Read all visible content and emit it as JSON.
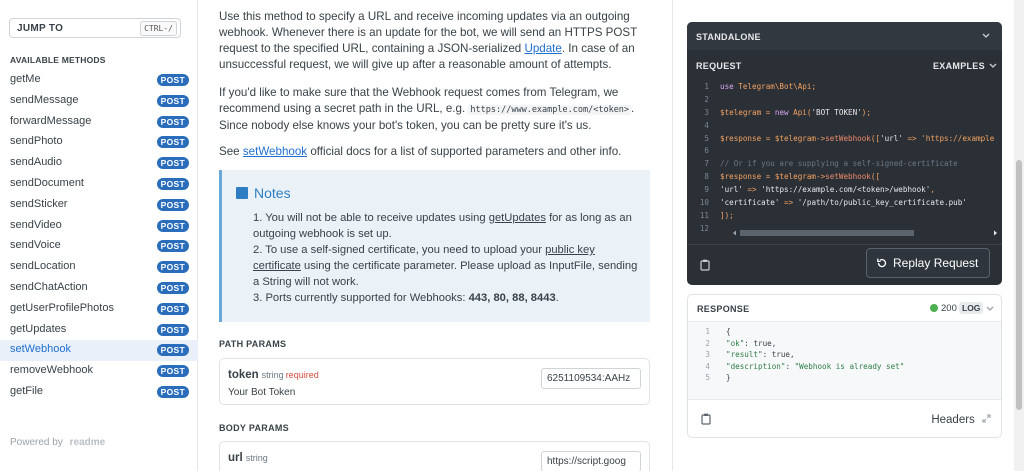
{
  "sidebar": {
    "jump_to": "JUMP TO",
    "jump_shortcut": "CTRL-/",
    "methods_title": "AVAILABLE METHODS",
    "badge": "POST",
    "items": [
      {
        "label": "getMe"
      },
      {
        "label": "sendMessage"
      },
      {
        "label": "forwardMessage"
      },
      {
        "label": "sendPhoto"
      },
      {
        "label": "sendAudio"
      },
      {
        "label": "sendDocument"
      },
      {
        "label": "sendSticker"
      },
      {
        "label": "sendVideo"
      },
      {
        "label": "sendVoice"
      },
      {
        "label": "sendLocation"
      },
      {
        "label": "sendChatAction"
      },
      {
        "label": "getUserProfilePhotos"
      },
      {
        "label": "getUpdates"
      },
      {
        "label": "setWebhook"
      },
      {
        "label": "removeWebhook"
      },
      {
        "label": "getFile"
      }
    ],
    "active_item": "setWebhook",
    "powered_by": "Powered by",
    "brand": "readme"
  },
  "main": {
    "intro_before_link": "Use this method to specify a URL and receive incoming updates via an outgoing webhook. Whenever there is an update for the bot, we will send an HTTPS POST request to the specified URL, containing a JSON-serialized ",
    "intro_link": "Update",
    "intro_after_link": ". In case of an unsuccessful request, we will give up after a reasonable amount of attempts.",
    "secret_before": "If you'd like to make sure that the Webhook request comes from Telegram, we recommend using a secret path in the URL, e.g. ",
    "secret_code": "https://www.example.com/<token>",
    "secret_after": ". Since nobody else knows your bot's token, you can be pretty sure it's us.",
    "see_prefix": "See ",
    "see_link": "setWebhook",
    "see_suffix": " official docs for a list of supported parameters and other info.",
    "notes": {
      "title": "Notes",
      "n1_pre": "1. You will not be able to receive updates using ",
      "n1_link": "getUpdates",
      "n1_post": " for as long as an outgoing webhook is set up.",
      "n2_pre": "2. To use a self-signed certificate, you need to upload your ",
      "n2_link": "public key certificate",
      "n2_post": " using the certificate parameter. Please upload as InputFile, sending a String will not work.",
      "n3_pre": "3. Ports currently supported for Webhooks: ",
      "n3_ports": "443, 80, 88, 8443",
      "n3_post": "."
    },
    "path_params_title": "PATH PARAMS",
    "token_param": {
      "name": "token",
      "type": "string",
      "required": "required",
      "description": "Your Bot Token",
      "value": "6251109534:AAHz"
    },
    "body_params_title": "BODY PARAMS",
    "url_param": {
      "name": "url",
      "type": "string",
      "value": "https://script.goog"
    }
  },
  "request_panel": {
    "mode": "STANDALONE",
    "request_label": "REQUEST",
    "examples_label": "EXAMPLES",
    "code_lines": [
      {
        "n": "1",
        "text": "use Telegram\\Bot\\Api;"
      },
      {
        "n": "2",
        "text": ""
      },
      {
        "n": "3",
        "text": "$telegram = new Api('BOT TOKEN');"
      },
      {
        "n": "4",
        "text": ""
      },
      {
        "n": "5",
        "text": "$response = $telegram->setWebhook(['url' => 'https://example"
      },
      {
        "n": "6",
        "text": ""
      },
      {
        "n": "7",
        "text": "// Or if you are supplying a self-signed-certificate"
      },
      {
        "n": "8",
        "text": "$response = $telegram->setWebhook(["
      },
      {
        "n": "9",
        "text": "  'url' => 'https://example.com/<token>/webhook',"
      },
      {
        "n": "10",
        "text": "  'certificate' => '/path/to/public_key_certificate.pub'"
      },
      {
        "n": "11",
        "text": "]);"
      },
      {
        "n": "12",
        "text": ""
      }
    ],
    "replay_label": "Replay Request"
  },
  "response_panel": {
    "label": "RESPONSE",
    "status": "200",
    "log_label": "LOG",
    "status_color": "#4caf50",
    "lines": [
      {
        "n": "1",
        "text": "{"
      },
      {
        "n": "2",
        "text": "  \"ok\": true,"
      },
      {
        "n": "3",
        "text": "  \"result\": true,"
      },
      {
        "n": "4",
        "text": "  \"description\": \"Webhook is already set\""
      },
      {
        "n": "5",
        "text": "}"
      }
    ],
    "headers_label": "Headers"
  }
}
